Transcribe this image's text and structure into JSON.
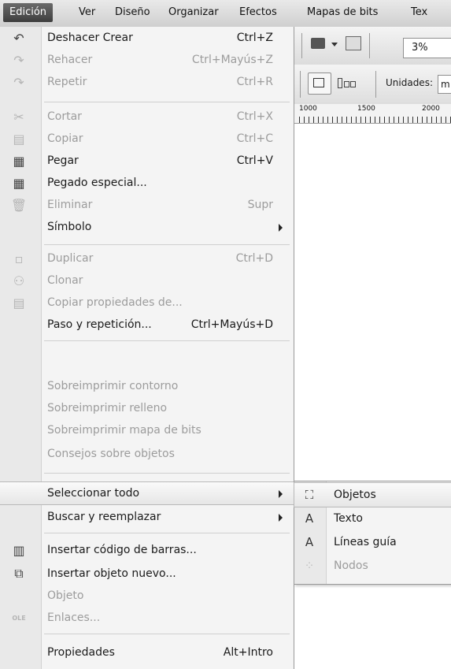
{
  "menubar": {
    "items": [
      "Edición",
      "Ver",
      "Diseño",
      "Organizar",
      "Efectos",
      "Mapas de bits",
      "Tex"
    ]
  },
  "toolbar": {
    "zoom": "3%",
    "units_label": "Unidades:",
    "units_value": "m"
  },
  "ruler": {
    "labels": [
      "1000",
      "1500",
      "2000"
    ]
  },
  "menu": {
    "items": [
      {
        "label": "Deshacer Crear",
        "shortcut": "Ctrl+Z",
        "icon": "undo-icon"
      },
      {
        "label": "Rehacer",
        "shortcut": "Ctrl+Mayús+Z",
        "icon": "redo-icon"
      },
      {
        "label": "Repetir",
        "shortcut": "Ctrl+R",
        "icon": "repeat-icon"
      },
      {
        "label": "Cortar",
        "shortcut": "Ctrl+X",
        "icon": "scissors-icon"
      },
      {
        "label": "Copiar",
        "shortcut": "Ctrl+C",
        "icon": "copy-icon"
      },
      {
        "label": "Pegar",
        "shortcut": "Ctrl+V",
        "icon": "paste-icon"
      },
      {
        "label": "Pegado especial...",
        "shortcut": "",
        "icon": "paste-special-icon"
      },
      {
        "label": "Eliminar",
        "shortcut": "Supr",
        "icon": "trash-icon"
      },
      {
        "label": "Símbolo",
        "shortcut": "",
        "icon": ""
      },
      {
        "label": "Duplicar",
        "shortcut": "Ctrl+D",
        "icon": "duplicate-icon"
      },
      {
        "label": "Clonar",
        "shortcut": "",
        "icon": "clone-icon"
      },
      {
        "label": "Copiar propiedades de...",
        "shortcut": "",
        "icon": "copy-properties-icon"
      },
      {
        "label": "Paso y repetición...",
        "shortcut": "Ctrl+Mayús+D",
        "icon": ""
      },
      {
        "label": "Sobreimprimir contorno",
        "shortcut": "",
        "icon": ""
      },
      {
        "label": "Sobreimprimir relleno",
        "shortcut": "",
        "icon": ""
      },
      {
        "label": "Sobreimprimir mapa de bits",
        "shortcut": "",
        "icon": ""
      },
      {
        "label": "Consejos sobre objetos",
        "shortcut": "",
        "icon": ""
      },
      {
        "label": "Seleccionar todo",
        "shortcut": "",
        "icon": ""
      },
      {
        "label": "Buscar y reemplazar",
        "shortcut": "",
        "icon": ""
      },
      {
        "label": "Insertar código de barras...",
        "shortcut": "",
        "icon": "barcode-icon"
      },
      {
        "label": "Insertar objeto nuevo...",
        "shortcut": "",
        "icon": "insert-object-icon"
      },
      {
        "label": "Objeto",
        "shortcut": "",
        "icon": ""
      },
      {
        "label": "Enlaces...",
        "shortcut": "",
        "icon": "ole-icon"
      },
      {
        "label": "Propiedades",
        "shortcut": "Alt+Intro",
        "icon": ""
      }
    ]
  },
  "submenu": {
    "items": [
      {
        "label": "Objetos",
        "icon": "select-objects-icon"
      },
      {
        "label": "Texto",
        "icon": "select-text-icon"
      },
      {
        "label": "Líneas guía",
        "icon": "select-guides-icon"
      },
      {
        "label": "Nodos",
        "icon": "select-nodes-icon"
      }
    ]
  },
  "icons": {
    "ole_text": "OLE"
  }
}
